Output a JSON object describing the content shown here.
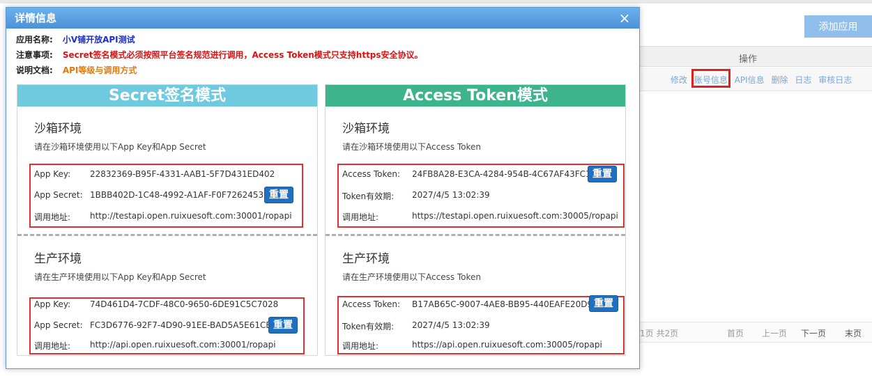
{
  "background": {
    "add_app_button": "添加应用",
    "column_header": "操作",
    "actions": [
      "修改",
      "账号信息",
      "API信息",
      "删除",
      "日志",
      "审核日志"
    ],
    "pager_info": "1页 共2页",
    "pager_buttons": [
      "首页",
      "上一页",
      "下一页",
      "末页"
    ]
  },
  "dialog": {
    "title": "详情信息",
    "close_label": "×",
    "info": [
      {
        "label": "应用名称:",
        "value": "小V铺开放API测试"
      },
      {
        "label": "注意事项:",
        "value": "Secret签名模式必须按照平台签名规范进行调用，Access Token模式只支持https安全协议。"
      },
      {
        "label": "说明文档:",
        "value": "API等级与调用方式"
      }
    ],
    "secret_panel": {
      "title": "Secret签名模式",
      "sandbox": {
        "title": "沙箱环境",
        "desc": "请在沙箱环境使用以下App Key和App Secret",
        "rows": [
          {
            "key": "App Key:",
            "value": "22832369-B95F-4331-AAB1-5F7D431ED402"
          },
          {
            "key": "App Secret:",
            "value": "1BBB402D-1C48-4992-A1AF-F0F726245381"
          },
          {
            "key": "调用地址:",
            "value": "http://testapi.open.ruixuesoft.com:30001/ropapi"
          }
        ]
      },
      "production": {
        "title": "生产环境",
        "desc": "请在生产环境使用以下App Key和App Secret",
        "rows": [
          {
            "key": "App Key:",
            "value": "74D461D4-7CDF-48C0-9650-6DE91C5C7028"
          },
          {
            "key": "App Secret:",
            "value": "FC3D6776-92F7-4D90-91EE-BAD5A5E61CB5"
          },
          {
            "key": "调用地址:",
            "value": "http://api.open.ruixuesoft.com:30001/ropapi"
          }
        ]
      }
    },
    "token_panel": {
      "title": "Access Token模式",
      "sandbox": {
        "title": "沙箱环境",
        "desc": "请在沙箱环境使用以下Access Token",
        "rows": [
          {
            "key": "Access Token:",
            "value": "24FB8A28-E3CA-4284-954B-4C67AF43FC1F"
          },
          {
            "key": "Token有效期:",
            "value": "2027/4/5 13:02:39"
          },
          {
            "key": "调用地址:",
            "value": "https://testapi.open.ruixuesoft.com:30005/ropapi"
          }
        ]
      },
      "production": {
        "title": "生产环境",
        "desc": "请在生产环境使用以下Access Token",
        "rows": [
          {
            "key": "Access Token:",
            "value": "B17AB65C-9007-4AE8-BB95-440EAFE20D99"
          },
          {
            "key": "Token有效期:",
            "value": "2027/4/5 13:02:39"
          },
          {
            "key": "调用地址:",
            "value": "https://api.open.ruixuesoft.com:30005/ropapi"
          }
        ]
      }
    },
    "reset_label": "重置"
  }
}
